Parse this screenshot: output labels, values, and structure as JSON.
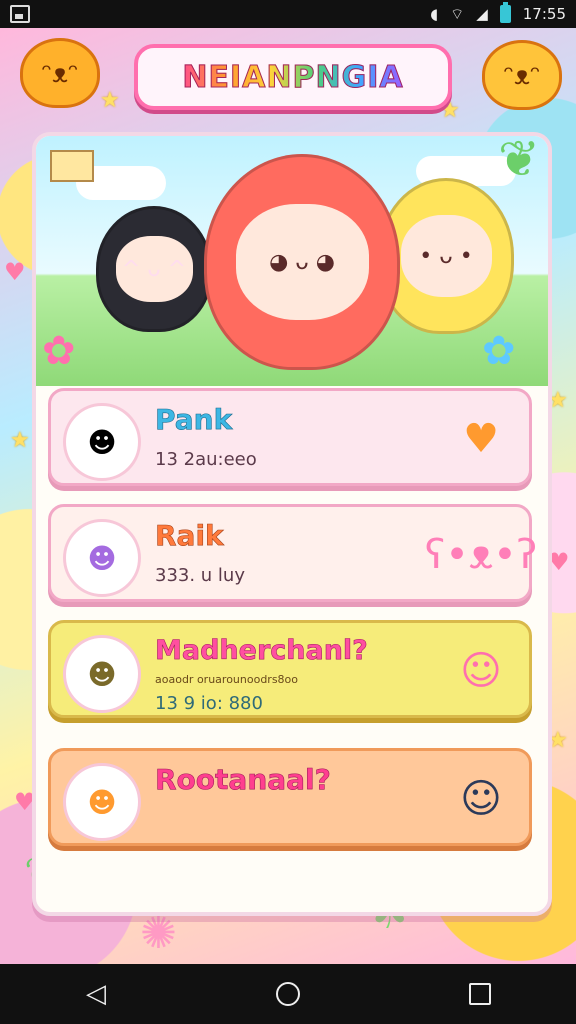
{
  "status_bar": {
    "time": "17:55"
  },
  "header": {
    "title": "NEIANPNGIA"
  },
  "cards": [
    {
      "title": "Pank",
      "subtitle": "13 2au:eeo",
      "avatar_icon": "avatar-black-hair",
      "right_icon": "heart-icon"
    },
    {
      "title": "Raik",
      "subtitle": "333. u luy",
      "avatar_icon": "avatar-purple-hair",
      "right_icon": "bear-hearts-icon"
    },
    {
      "title": "Madherchanl?",
      "description": "aoaodr oruarounoodrs8oo",
      "subtitle": "13 9 io: 880",
      "avatar_icon": "avatar-olive-hair",
      "right_icon": "pink-girl-icon"
    },
    {
      "title": "Rootanaal?",
      "subtitle": "",
      "avatar_icon": "avatar-orange-hair",
      "right_icon": "dark-girl-icon"
    }
  ],
  "colors": {
    "accent": "#ff6fae",
    "card_yellow": "#f6ec7a",
    "card_orange": "#ffc89a"
  },
  "icons": {
    "status_left": "photo-icon",
    "status_right": [
      "do-not-disturb-icon",
      "wifi-icon",
      "signal-icon",
      "battery-icon"
    ],
    "nav": [
      "back-icon",
      "home-icon",
      "recents-icon"
    ]
  }
}
